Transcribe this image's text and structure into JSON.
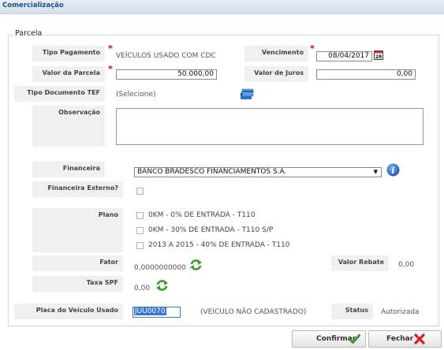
{
  "window": {
    "title": "Comercialização"
  },
  "section": {
    "legend": "Parcela"
  },
  "fields": {
    "tipo_pagamento": {
      "label": "Tipo Pagamento",
      "value": "VEÍCULOS USADO COM CDC"
    },
    "vencimento": {
      "label": "Vencimento",
      "value": "08/04/2017"
    },
    "valor_parcela": {
      "label": "Valor da Parcela",
      "value": "50.000,00"
    },
    "valor_juros": {
      "label": "Valor de Juros",
      "value": "0,00"
    },
    "tipo_documento_tef": {
      "label": "Tipo Documento TEF",
      "value": "(Selecione)"
    },
    "observacao": {
      "label": "Observação",
      "value": ""
    },
    "financeira": {
      "label": "Financeira",
      "value": "BANCO BRADESCO FINANCIAMENTOS S.A."
    },
    "financeira_externo": {
      "label": "Financeira Externo?",
      "checked": false
    },
    "plano": {
      "label": "Plano",
      "options": [
        {
          "label": "0KM - 0% DE ENTRADA - T110",
          "checked": false
        },
        {
          "label": "0KM - 30% DE ENTRADA - T110 S/P",
          "checked": false
        },
        {
          "label": "2013 A 2015 - 40% DE ENTRADA - T110",
          "checked": false
        }
      ]
    },
    "fator": {
      "label": "Fator",
      "value": "0,0000000000"
    },
    "valor_rebate": {
      "label": "Valor Rebate",
      "value": "0,00"
    },
    "taxa_spf": {
      "label": "Taxa SPF",
      "value": "0,00"
    },
    "placa": {
      "label": "Placa do Veículo Usado",
      "value": "JUU0070",
      "note": "(VEÍCULO NÃO CADASTRADO)"
    },
    "status": {
      "label": "Status",
      "value": "Autorizada"
    }
  },
  "buttons": {
    "confirmar": "Confirmar",
    "fechar": "Fechar"
  },
  "colors": {
    "required": "#cc0000",
    "refresh_green": "#3a9b2e",
    "info_blue": "#2f6fc6",
    "title_text": "#1f4f8c"
  },
  "icons": [
    "calendar-icon",
    "card-icon",
    "info-icon",
    "refresh-icon",
    "check-icon",
    "x-icon"
  ]
}
